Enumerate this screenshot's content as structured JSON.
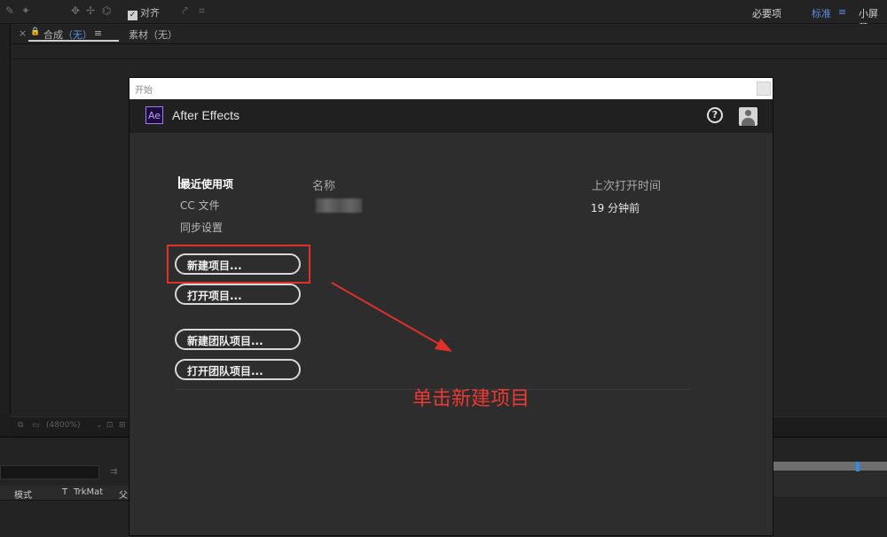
{
  "toolbar": {
    "snap_checkbox": "✓",
    "snap_label": "对齐",
    "workspaces": [
      "必要项",
      "标准",
      "≡",
      "小屏幕"
    ]
  },
  "tabs": {
    "close": "×",
    "lock": "🔒",
    "comp_prefix": "合成",
    "comp_value": "（无）",
    "menu": "≡",
    "footage": "素材（无）"
  },
  "viewer": {
    "zoom": "(4800%)"
  },
  "timeline": {
    "col_mode": "模式",
    "col_t": "T",
    "col_trkmat": "TrkMat",
    "col_parent": "父"
  },
  "dialog": {
    "title": "开始",
    "logo": "Ae",
    "app_name": "After Effects",
    "help": "?",
    "nav": [
      "最近使用项",
      "CC 文件",
      "同步设置"
    ],
    "col_name": "名称",
    "col_last_opened": "上次打开时间",
    "recent_time": "19 分钟前",
    "buttons": [
      "新建项目...",
      "打开项目...",
      "新建团队项目...",
      "打开团队项目..."
    ]
  },
  "annotation": {
    "text": "单击新建项目",
    "color": "#ea3a33"
  }
}
